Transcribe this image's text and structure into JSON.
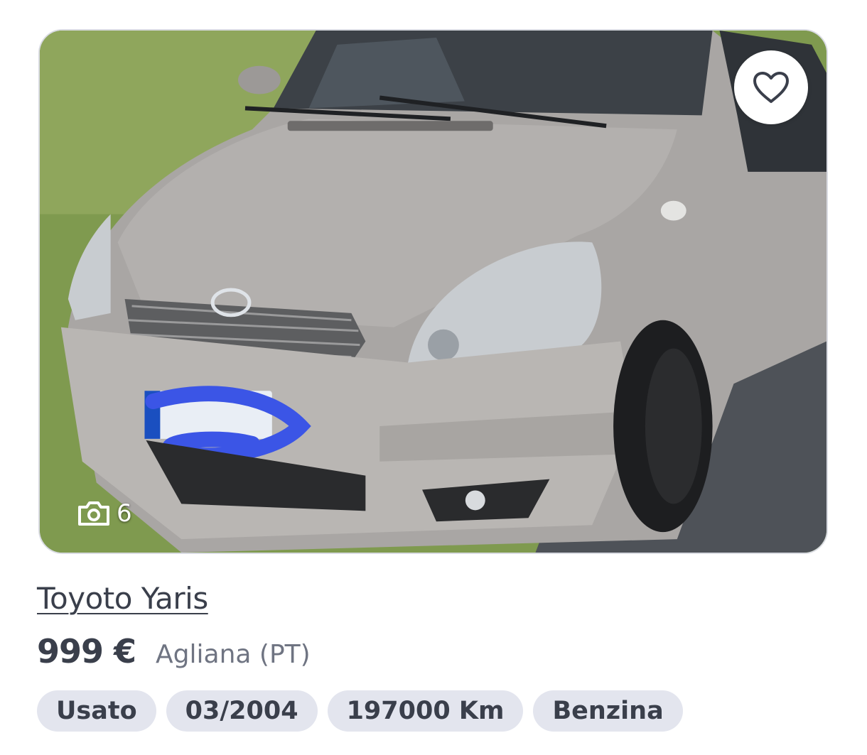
{
  "listing": {
    "title": "Toyoto Yaris",
    "price": "999 €",
    "location": "Agliana (PT)",
    "photo_count": "6",
    "tags": [
      "Usato",
      "03/2004",
      "197000 Km",
      "Benzina"
    ],
    "favorite_icon": "heart-outline-icon",
    "camera_icon": "camera-icon"
  },
  "colors": {
    "text_primary": "#3a3f4b",
    "text_secondary": "#6f7482",
    "tag_background": "#e3e5ee"
  }
}
